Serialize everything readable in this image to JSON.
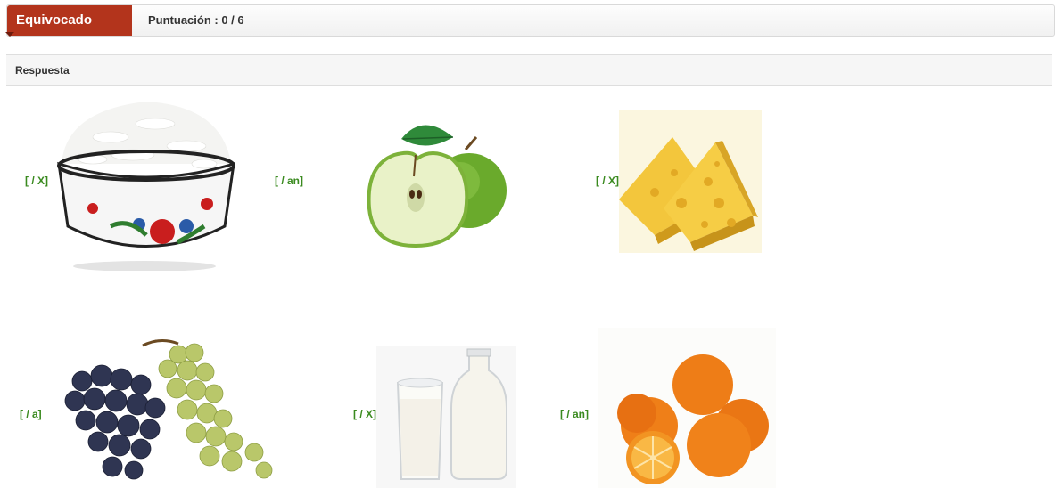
{
  "result": {
    "status_label": "Equivocado",
    "score_label": "Puntuación : 0 / 6",
    "status_color": "#b3341c"
  },
  "answer_section": {
    "title": "Respuesta"
  },
  "items": [
    {
      "label": "[ / X]",
      "icon": "rice-bowl-image"
    },
    {
      "label": "[ / an]",
      "icon": "green-apple-image"
    },
    {
      "label": "[ / X]",
      "icon": "cheese-image"
    },
    {
      "label": "[ / a]",
      "icon": "grapes-image"
    },
    {
      "label": "[ / X]",
      "icon": "milk-image"
    },
    {
      "label": "[ / an]",
      "icon": "oranges-image"
    }
  ]
}
